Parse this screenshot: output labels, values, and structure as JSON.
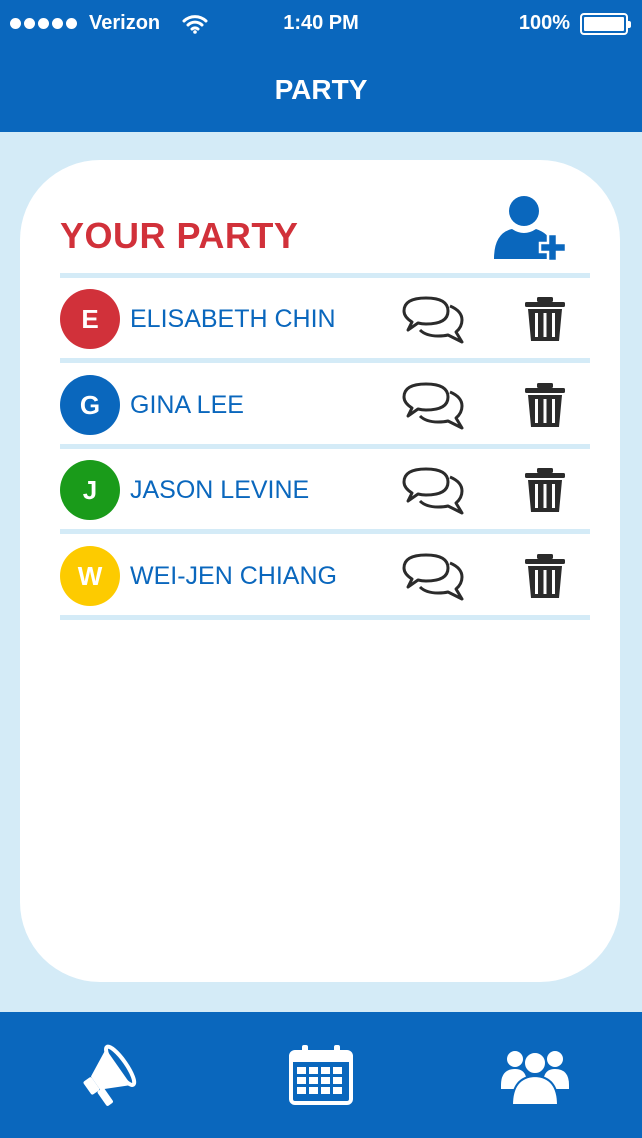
{
  "status": {
    "carrier": "Verizon",
    "time": "1:40 PM",
    "battery": "100%",
    "battery_level": 1.0
  },
  "nav": {
    "title": "PARTY"
  },
  "card": {
    "title": "YOUR PARTY"
  },
  "members": [
    {
      "initial": "E",
      "name": "ELISABETH CHIN",
      "color": "#d1313a"
    },
    {
      "initial": "G",
      "name": "GINA LEE",
      "color": "#0a67bd"
    },
    {
      "initial": "J",
      "name": "JASON LEVINE",
      "color": "#1a9b1a"
    },
    {
      "initial": "W",
      "name": "WEI-JEN CHIANG",
      "color": "#fdcb00"
    }
  ],
  "icons": {
    "add": "add-user-icon",
    "chat": "chat-bubbles-icon",
    "delete": "trash-icon",
    "tabs": [
      "megaphone-icon",
      "calendar-icon",
      "group-icon"
    ]
  },
  "colors": {
    "primary": "#0a67bd",
    "accent": "#d1313a",
    "background": "#d4ebf7"
  }
}
